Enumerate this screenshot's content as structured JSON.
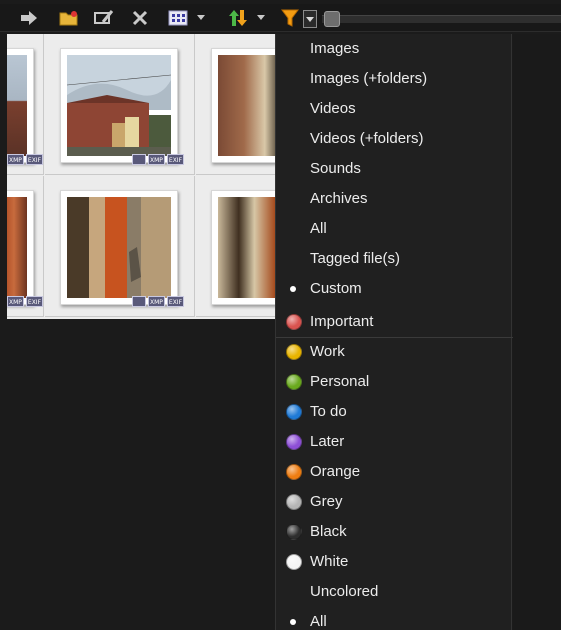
{
  "toolbar": {
    "buttons": [
      {
        "name": "forward-arrow-icon"
      },
      {
        "name": "new-folder-icon"
      },
      {
        "name": "rename-icon"
      },
      {
        "name": "delete-icon"
      },
      {
        "name": "view-mode-icon"
      },
      {
        "name": "sort-icon"
      },
      {
        "name": "filter-icon"
      }
    ]
  },
  "thumbnails": {
    "badges": {
      "edit": "",
      "xmp": "XMP",
      "exif": "EXIF"
    }
  },
  "filter_menu": {
    "type_items": [
      {
        "label": "Images",
        "selected": false
      },
      {
        "label": "Images (+folders)",
        "selected": false
      },
      {
        "label": "Videos",
        "selected": false
      },
      {
        "label": "Videos (+folders)",
        "selected": false
      },
      {
        "label": "Sounds",
        "selected": false
      },
      {
        "label": "Archives",
        "selected": false
      },
      {
        "label": "All",
        "selected": false
      },
      {
        "label": "Tagged file(s)",
        "selected": false
      },
      {
        "label": "Custom",
        "selected": true
      }
    ],
    "color_items": [
      {
        "label": "Important",
        "color": "#d9534f"
      },
      {
        "label": "Work",
        "color": "#e8b400"
      },
      {
        "label": "Personal",
        "color": "#6aaa1e"
      },
      {
        "label": "To do",
        "color": "#1f7ad6"
      },
      {
        "label": "Later",
        "color": "#8d4fd6"
      },
      {
        "label": "Orange",
        "color": "#ee7d12"
      },
      {
        "label": "Grey",
        "color": "#b5b5b5"
      },
      {
        "label": "Black",
        "color": "#2e2e2e"
      },
      {
        "label": "White",
        "color": "#f4f4f4"
      },
      {
        "label": "Uncolored",
        "color": ""
      },
      {
        "label": "All",
        "color": "",
        "selected": true
      }
    ]
  },
  "colors": {
    "app_background": "#1b1b1b",
    "menu_background": "#202020",
    "browser_background": "#ececec"
  }
}
